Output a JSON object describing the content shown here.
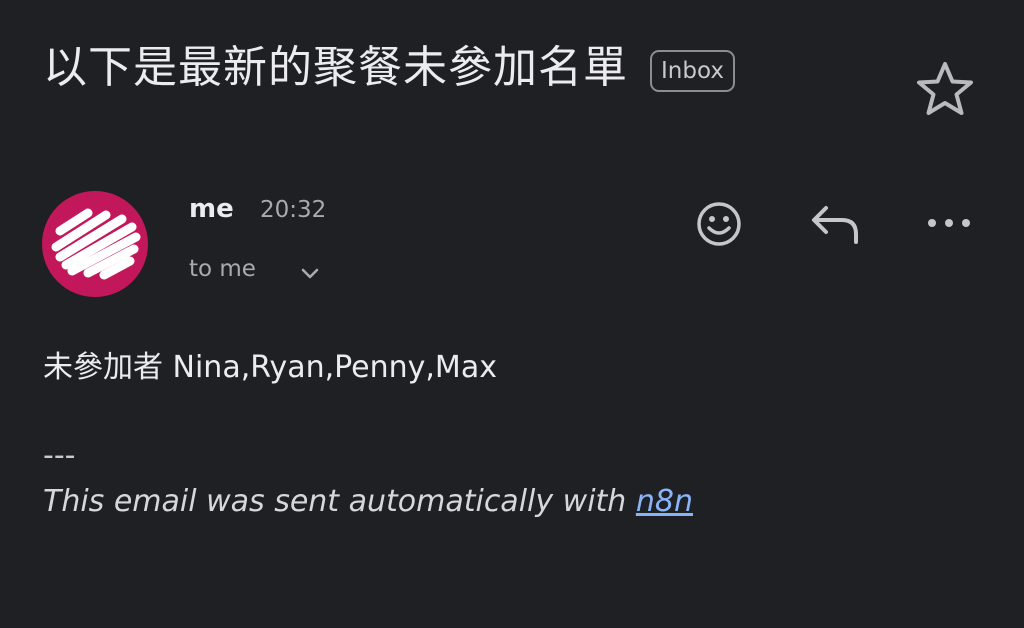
{
  "email": {
    "subject": "以下是最新的聚餐未參加名單",
    "label": "Inbox",
    "sender": {
      "name": "me",
      "time": "20:32",
      "recipient": "to me",
      "avatar_color": "#c2185b"
    },
    "body": {
      "absent_line": "未參加者 Nina,Ryan,Penny,Max",
      "separator": "---",
      "footer_text": "This email was sent automatically with ",
      "footer_link": "n8n"
    }
  },
  "icons": {
    "star": "star-icon",
    "chevron": "chevron-down-icon",
    "emoji": "smiley-icon",
    "reply": "reply-icon",
    "more": "more-horizontal-icon"
  },
  "colors": {
    "background": "#1f2024",
    "link": "#8ab4f8",
    "text_secondary": "#a9aaae"
  }
}
